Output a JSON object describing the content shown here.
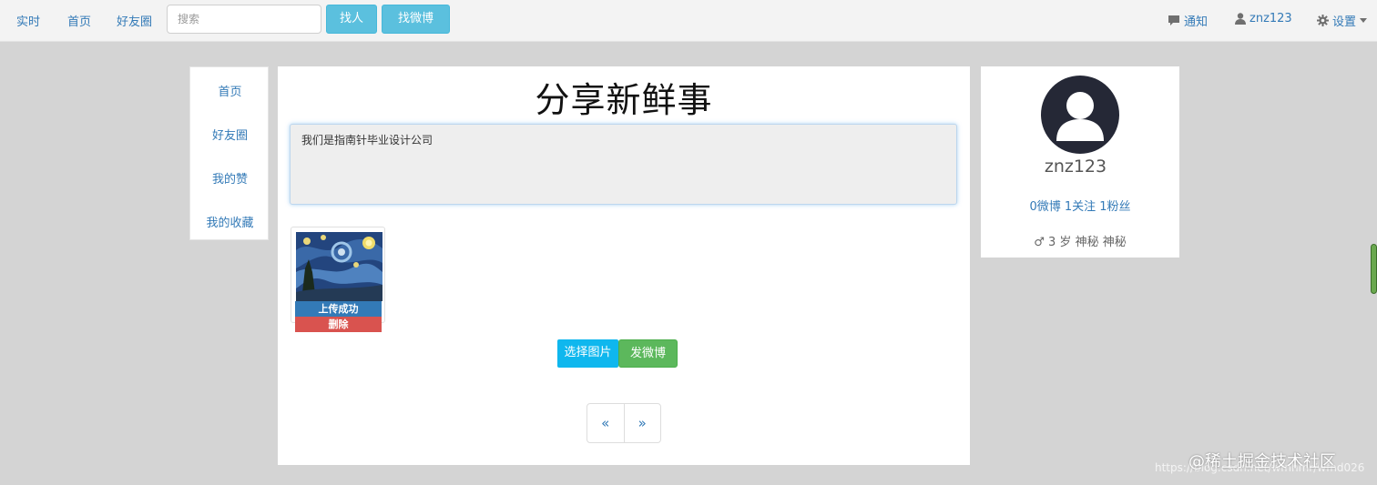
{
  "navbar": {
    "items": [
      {
        "label": "实时"
      },
      {
        "label": "首页"
      },
      {
        "label": "好友圈"
      }
    ],
    "search": {
      "placeholder": "搜索",
      "value": ""
    },
    "find_person_label": "找人",
    "find_weibo_label": "找微博",
    "notification_label": "通知",
    "username": "znz123",
    "settings_label": "设置"
  },
  "left_menu": {
    "items": [
      {
        "label": "首页"
      },
      {
        "label": "好友圈"
      },
      {
        "label": "我的赞"
      },
      {
        "label": "我的收藏"
      }
    ]
  },
  "main": {
    "title": "分享新鲜事",
    "textarea_value": "我们是指南针毕业设计公司",
    "upload_status": "上传成功",
    "delete_label": "删除",
    "choose_image_label": "选择图片",
    "post_label": "发微博",
    "pagination": {
      "prev": "«",
      "next": "»"
    }
  },
  "profile": {
    "username": "znz123",
    "weibo_count": "0微博",
    "following_count": "1关注",
    "fans_count": "1粉丝",
    "gender_symbol": "♂",
    "age": "3 岁",
    "tag1": "神秘",
    "tag2": "神秘"
  },
  "watermark": {
    "main": "@稀土掘金技术社区",
    "url": "https://blog.csdn.net/wfnhmr/wfnd026"
  },
  "colors": {
    "link": "#337ab7",
    "info_button": "#5bc0de",
    "success_button": "#5cb85c",
    "danger": "#d9534f",
    "primary": "#337ab7"
  }
}
